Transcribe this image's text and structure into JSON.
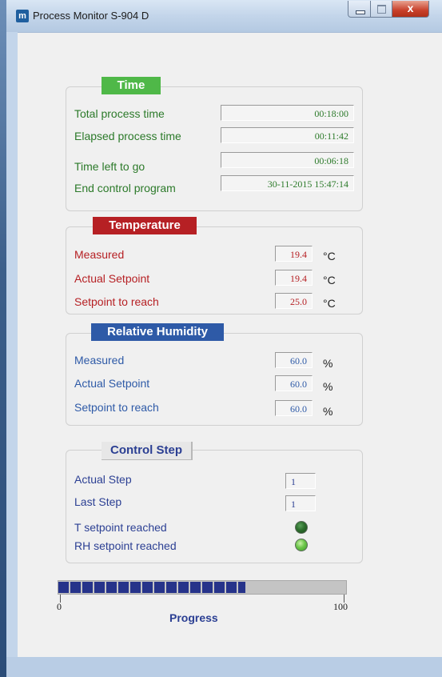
{
  "window": {
    "title": "Process Monitor S-904 D",
    "app_icon_letter": "m",
    "close_glyph": "x"
  },
  "time": {
    "legend": "Time",
    "rows": [
      {
        "label": "Total process time",
        "value": "00:18:00"
      },
      {
        "label": "Elapsed process time",
        "value": "00:11:42"
      },
      {
        "label": "Time left to go",
        "value": "00:06:18"
      },
      {
        "label": "End control program",
        "value": "30-11-2015 15:47:14"
      }
    ]
  },
  "temperature": {
    "legend": "Temperature",
    "unit": "°C",
    "rows": [
      {
        "label": "Measured",
        "value": "19.4"
      },
      {
        "label": "Actual Setpoint",
        "value": "19.4"
      },
      {
        "label": "Setpoint to reach",
        "value": "25.0"
      }
    ]
  },
  "humidity": {
    "legend": "Relative Humidity",
    "unit": "%",
    "rows": [
      {
        "label": "Measured",
        "value": "60.0"
      },
      {
        "label": "Actual Setpoint",
        "value": "60.0"
      },
      {
        "label": "Setpoint to reach",
        "value": "60.0"
      }
    ]
  },
  "control": {
    "legend": "Control Step",
    "actual_step_label": "Actual Step",
    "actual_step_value": "1",
    "last_step_label": "Last Step",
    "last_step_value": "1",
    "t_reached_label": "T setpoint reached",
    "rh_reached_label": "RH setpoint reached"
  },
  "progress": {
    "label": "Progress",
    "min_label": "0",
    "max_label": "100",
    "fraction": 0.65
  },
  "colors": {
    "time_accent": "#4fb848",
    "temp_accent": "#b62024",
    "rh_accent": "#2e5aa7",
    "control_accent": "#2b3f93",
    "progress_fill": "#26338a"
  }
}
